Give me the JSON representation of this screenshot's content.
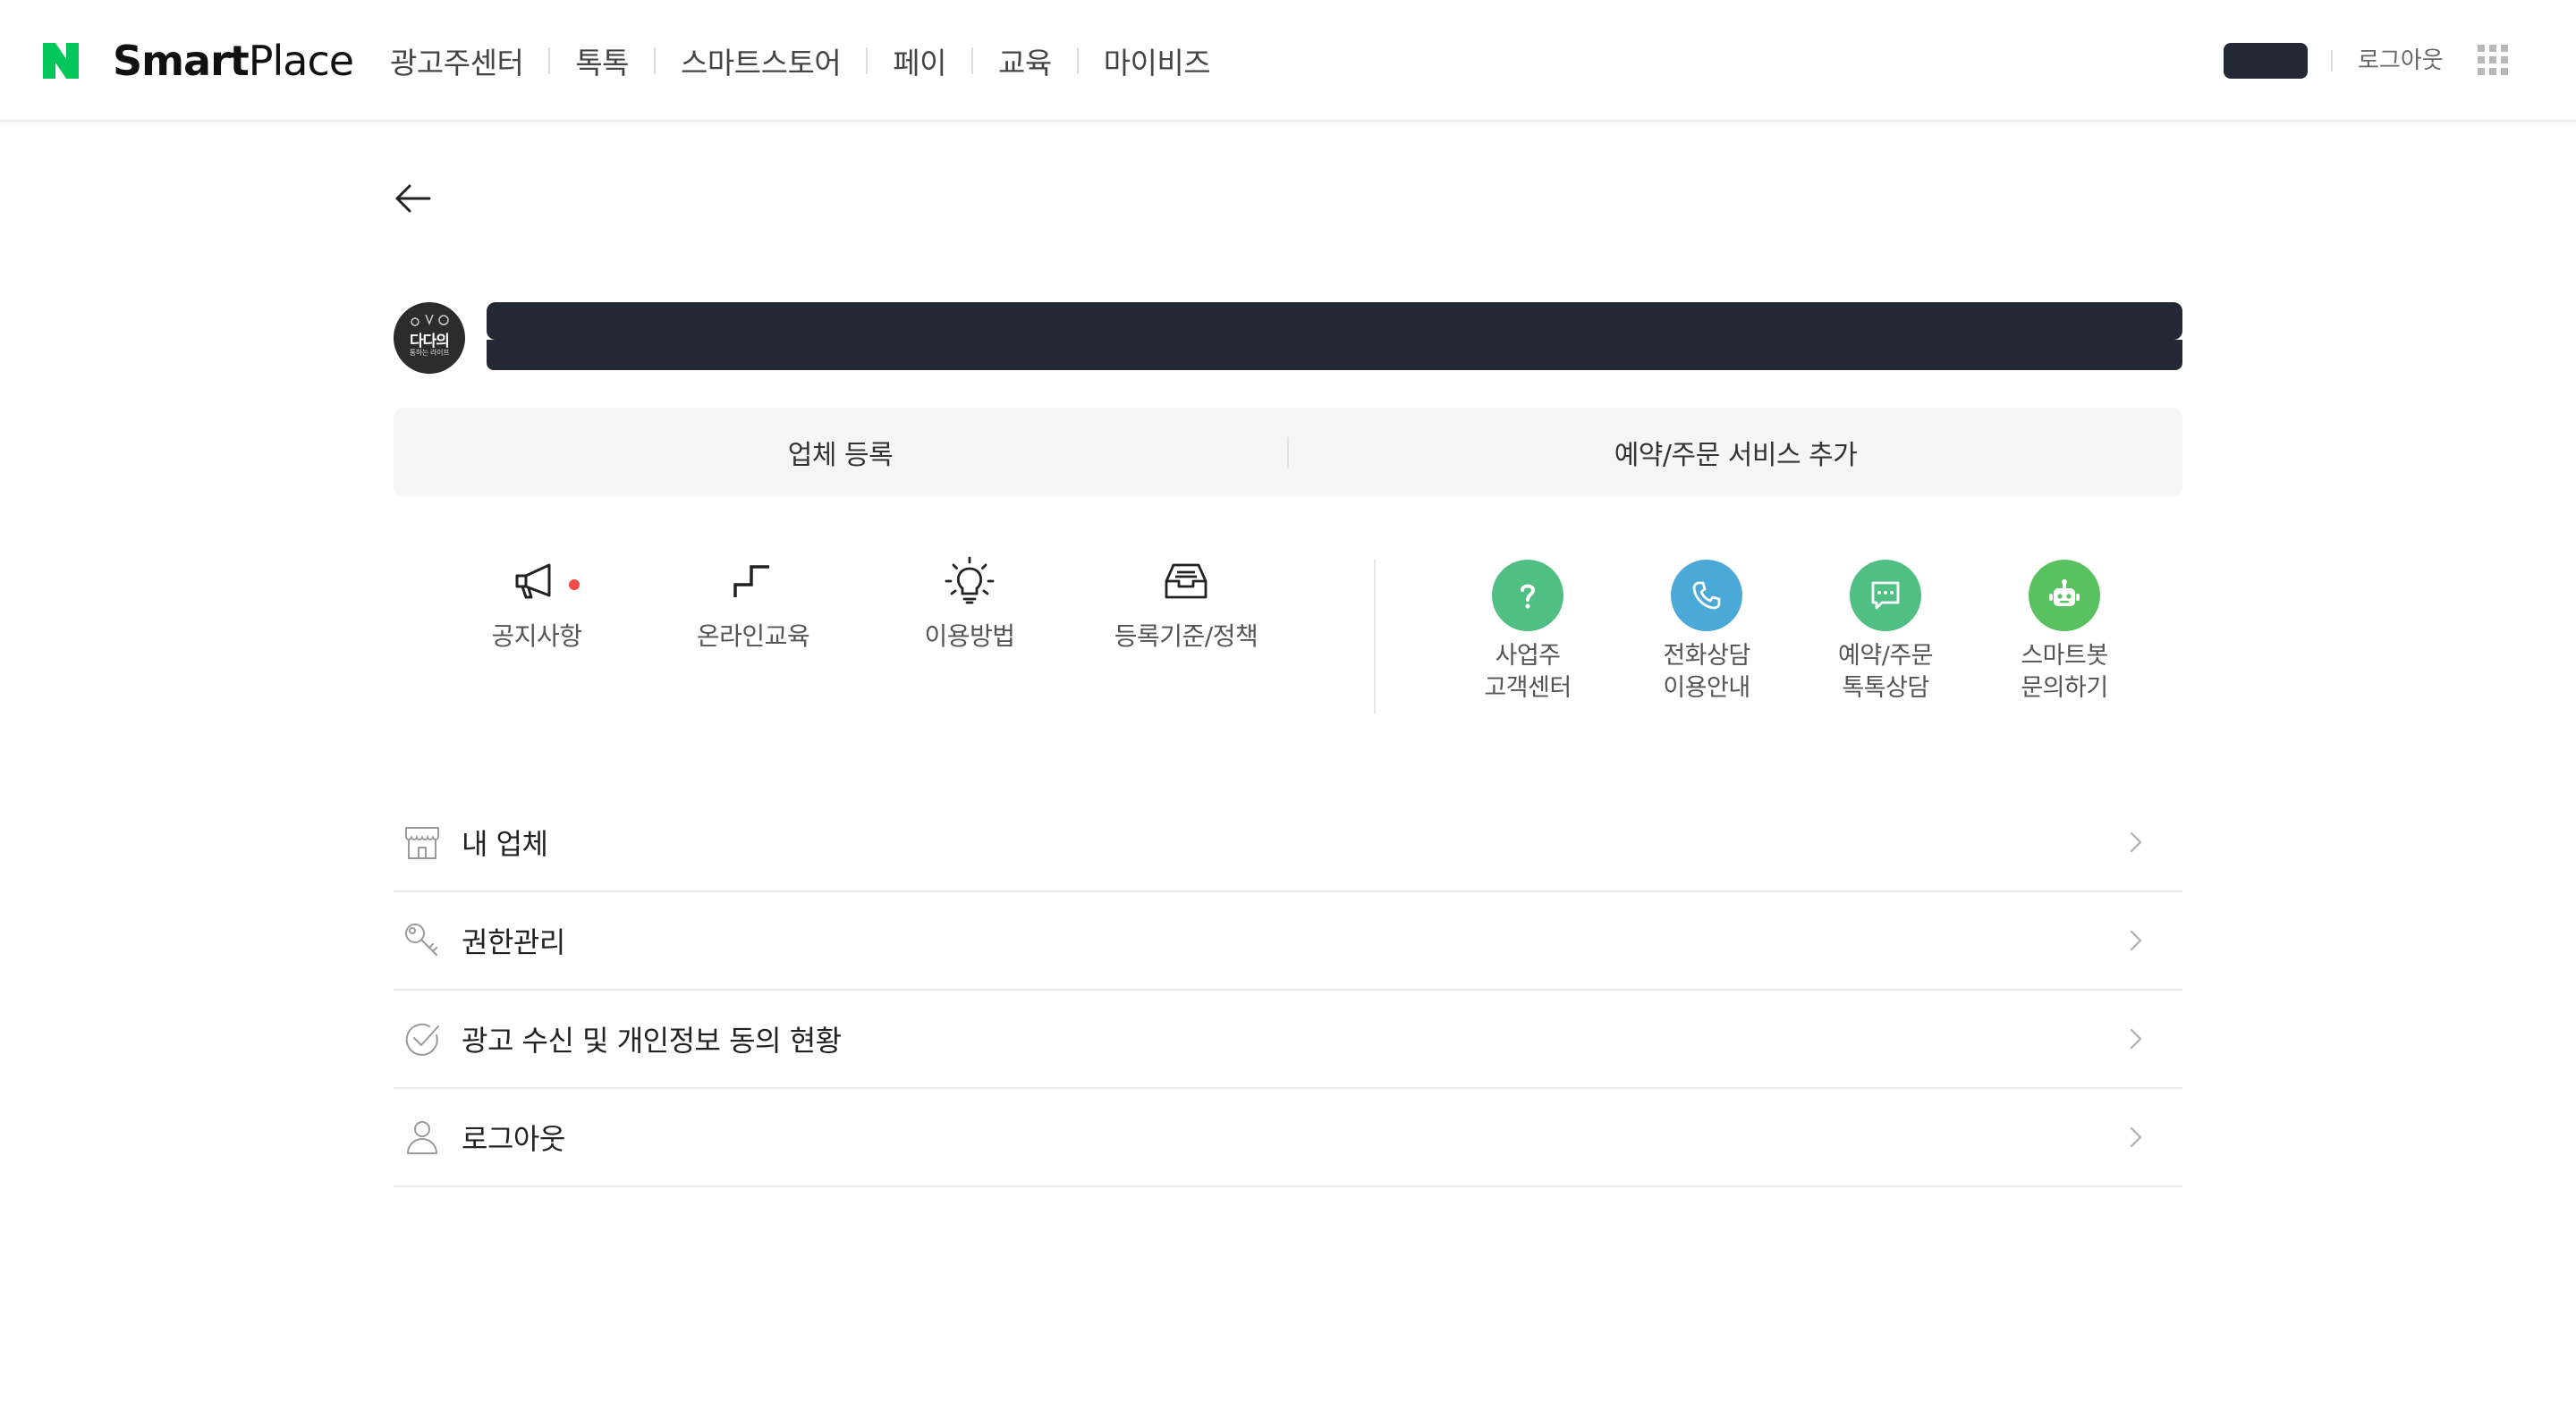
{
  "header": {
    "brand_bold": "Smart",
    "brand_regular": "Place",
    "nav": [
      "광고주센터",
      "톡톡",
      "스마트스토어",
      "페이",
      "교육",
      "마이비즈"
    ],
    "logout_label": "로그아웃",
    "brand_color": "#03c75a"
  },
  "profile": {
    "avatar_text": "다다의",
    "avatar_sub": "통하는 라이프"
  },
  "actions": {
    "register_label": "업체 등록",
    "add_service_label": "예약/주문 서비스 추가"
  },
  "quick_menu": [
    {
      "label": "공지사항",
      "icon": "megaphone-icon"
    },
    {
      "label": "온라인교육",
      "icon": "stairs-icon"
    },
    {
      "label": "이용방법",
      "icon": "lightbulb-icon"
    },
    {
      "label": "등록기준/정책",
      "icon": "inbox-tray-icon"
    }
  ],
  "contact_menu": [
    {
      "line1": "사업주",
      "line2": "고객센터",
      "icon": "question-icon",
      "color": "#4fbf84"
    },
    {
      "line1": "전화상담",
      "line2": "이용안내",
      "icon": "phone-icon",
      "color": "#4aa9d6"
    },
    {
      "line1": "예약/주문",
      "line2": "톡톡상담",
      "icon": "chat-bubble-icon",
      "color": "#4fbf84"
    },
    {
      "line1": "스마트봇",
      "line2": "문의하기",
      "icon": "robot-icon",
      "color": "#5ac160"
    }
  ],
  "menu_list": [
    {
      "label": "내 업체",
      "icon": "store-icon"
    },
    {
      "label": "권한관리",
      "icon": "key-icon"
    },
    {
      "label": "광고 수신 및 개인정보 동의 현황",
      "icon": "check-circle-icon"
    },
    {
      "label": "로그아웃",
      "icon": "user-icon"
    }
  ]
}
